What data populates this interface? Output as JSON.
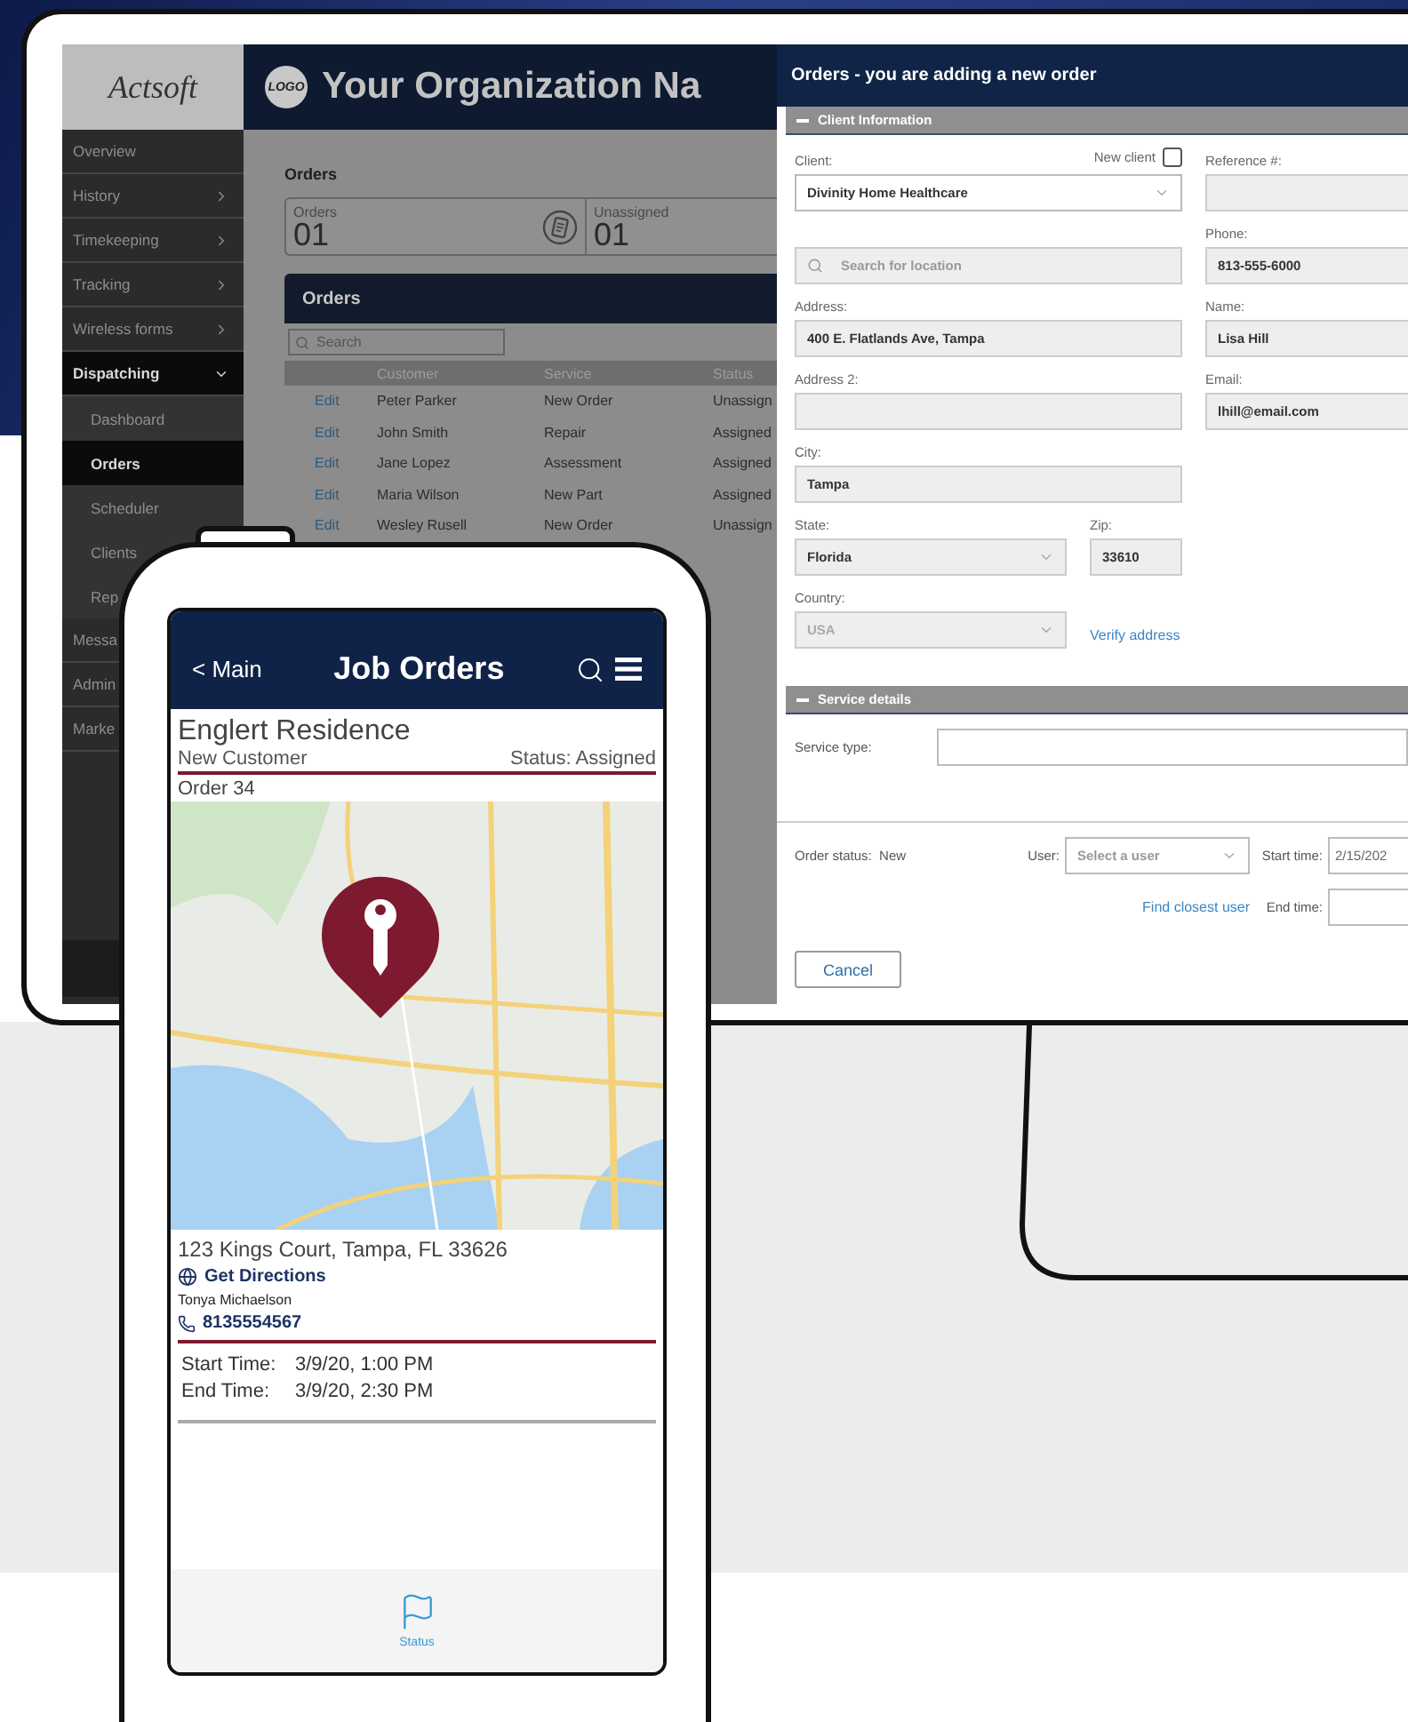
{
  "desktop": {
    "logo": "Actsoft",
    "logo_badge": "LOGO",
    "org_name": "Your Organization Na",
    "sidebar": [
      {
        "label": "Overview",
        "kind": "link",
        "selected": false
      },
      {
        "label": "History",
        "kind": "group",
        "expanded": false
      },
      {
        "label": "Timekeeping",
        "kind": "group",
        "expanded": false
      },
      {
        "label": "Tracking",
        "kind": "group",
        "expanded": false
      },
      {
        "label": "Wireless forms",
        "kind": "group",
        "expanded": false
      },
      {
        "label": "Dispatching",
        "kind": "group",
        "expanded": true,
        "children": [
          {
            "label": "Dashboard",
            "selected": false
          },
          {
            "label": "Orders",
            "selected": true
          },
          {
            "label": "Scheduler",
            "selected": false
          },
          {
            "label": "Clients",
            "selected": false
          },
          {
            "label": "Rep",
            "selected": false
          }
        ]
      },
      {
        "label": "Messa",
        "kind": "link",
        "selected": false
      },
      {
        "label": "Admin",
        "kind": "link",
        "selected": false
      },
      {
        "label": "Marke",
        "kind": "link",
        "selected": false
      }
    ],
    "page_title": "Orders",
    "stats": [
      {
        "label": "Orders",
        "value": "01"
      },
      {
        "label": "Unassigned",
        "value": "01"
      }
    ],
    "orders_panel": {
      "title": "Orders",
      "search_placeholder": "Search",
      "columns": [
        "Customer",
        "Service",
        "Status"
      ],
      "rows": [
        {
          "action": "Edit",
          "customer": "Peter Parker",
          "service": "New Order",
          "status": "Unassign"
        },
        {
          "action": "Edit",
          "customer": "John Smith",
          "service": "Repair",
          "status": "Assigned"
        },
        {
          "action": "Edit",
          "customer": "Jane Lopez",
          "service": "Assessment",
          "status": "Assigned"
        },
        {
          "action": "Edit",
          "customer": "Maria Wilson",
          "service": "New Part",
          "status": "Assigned"
        },
        {
          "action": "Edit",
          "customer": "Wesley Rusell",
          "service": "New Order",
          "status": "Unassign"
        }
      ]
    }
  },
  "modal": {
    "title": "Orders - you are adding a new order",
    "client_section": {
      "title": "Client Information",
      "expanded": true,
      "rows": [
        [
          {
            "kind": "select",
            "label": "Client:",
            "value": "Divinity Home Healthcare",
            "disabled": false,
            "aside": {
              "label": "New client",
              "checked": false
            }
          },
          {
            "kind": "input",
            "label": "Reference #:"
          }
        ],
        [
          {
            "kind": "search",
            "placeholder": "Search for location"
          },
          {
            "kind": "input",
            "label": "Phone:",
            "value": "813-555-6000"
          }
        ],
        [
          {
            "kind": "input",
            "label": "Address:",
            "value": "400 E. Flatlands Ave, Tampa"
          },
          {
            "kind": "input",
            "label": "Name:",
            "value": "Lisa Hill"
          }
        ],
        [
          {
            "kind": "input",
            "label": "Address 2:"
          },
          {
            "kind": "input",
            "label": "Email:",
            "value": "lhill@email.com"
          }
        ],
        [
          {
            "kind": "input",
            "label": "City:",
            "value": "Tampa"
          }
        ],
        [
          {
            "kind": "pair",
            "items": [
              {
                "kind": "select",
                "label": "State:",
                "value": "Florida",
                "disabled": false
              },
              {
                "kind": "input",
                "label": "Zip:",
                "value": "33610"
              }
            ]
          }
        ],
        [
          {
            "kind": "pair",
            "items": [
              {
                "kind": "select",
                "label": "Country:",
                "value": "USA",
                "disabled": true
              },
              {
                "kind": "link",
                "label": "Verify address"
              }
            ]
          }
        ]
      ]
    },
    "service_section": {
      "title": "Service details",
      "expanded": true,
      "service_type_label": "Service type:"
    },
    "footer": {
      "order_status_label": "Order status:",
      "order_status": "New",
      "user_label": "User:",
      "user_placeholder": "Select a user",
      "start_label": "Start time:",
      "start_value": "2/15/202",
      "find_user": "Find closest user",
      "end_label": "End time:"
    },
    "cancel": "Cancel"
  },
  "phone": {
    "back": "< Main",
    "title": "Job Orders",
    "job": {
      "name": "Englert Residence",
      "customer_type": "New Customer",
      "status": "Status: Assigned",
      "order": "Order 34",
      "address": "123 Kings Court, Tampa, FL 33626",
      "directions": "Get Directions",
      "contact": "Tonya Michaelson",
      "phone": "8135554567",
      "times": [
        {
          "label": "Start Time:",
          "value": "3/9/20, 1:00 PM"
        },
        {
          "label": "End Time:",
          "value": "3/9/20, 2:30 PM"
        }
      ]
    },
    "tabs": [
      {
        "label": "Status"
      }
    ]
  }
}
